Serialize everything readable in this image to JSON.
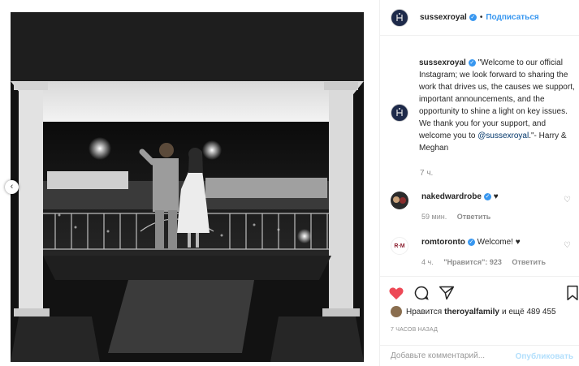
{
  "post": {
    "username": "sussexroyal",
    "follow_label": "Подписаться",
    "dot": "•",
    "verified_mark": "✓"
  },
  "caption": {
    "username": "sussexroyal",
    "text_before": " \"Welcome to our official Instagram; we look forward to sharing the work that drives us, the causes we support, important announcements, and the opportunity to shine a light on key issues. We thank you for your support, and welcome you to ",
    "mention": "@sussexroyal",
    "text_after": ".\"- Harry & Meghan",
    "time": "7 ч."
  },
  "comments": [
    {
      "username": "nakedwardrobe",
      "text": "♥",
      "time": "59 мин.",
      "likes": "",
      "reply": "Ответить",
      "verified": true
    },
    {
      "username": "romtoronto",
      "text": "Welcome! ♥",
      "time": "4 ч.",
      "likes": "\"Нравится\": 923",
      "reply": "Ответить",
      "verified": true,
      "avatar_text": "R·M"
    }
  ],
  "likes": {
    "prefix": "Нравится",
    "user": "theroyalfamily",
    "suffix": "и ещё 489 455"
  },
  "posted_time": "7 ЧАСОВ НАЗАД",
  "add_comment": {
    "placeholder": "Добавьте комментарий...",
    "publish_label": "Опубликовать"
  },
  "icons": {
    "carousel": "‹",
    "comment_heart": "♡"
  },
  "colors": {
    "accent": "#3897f0",
    "like_red": "#ed4956",
    "meta_grey": "#8e8e8e"
  }
}
